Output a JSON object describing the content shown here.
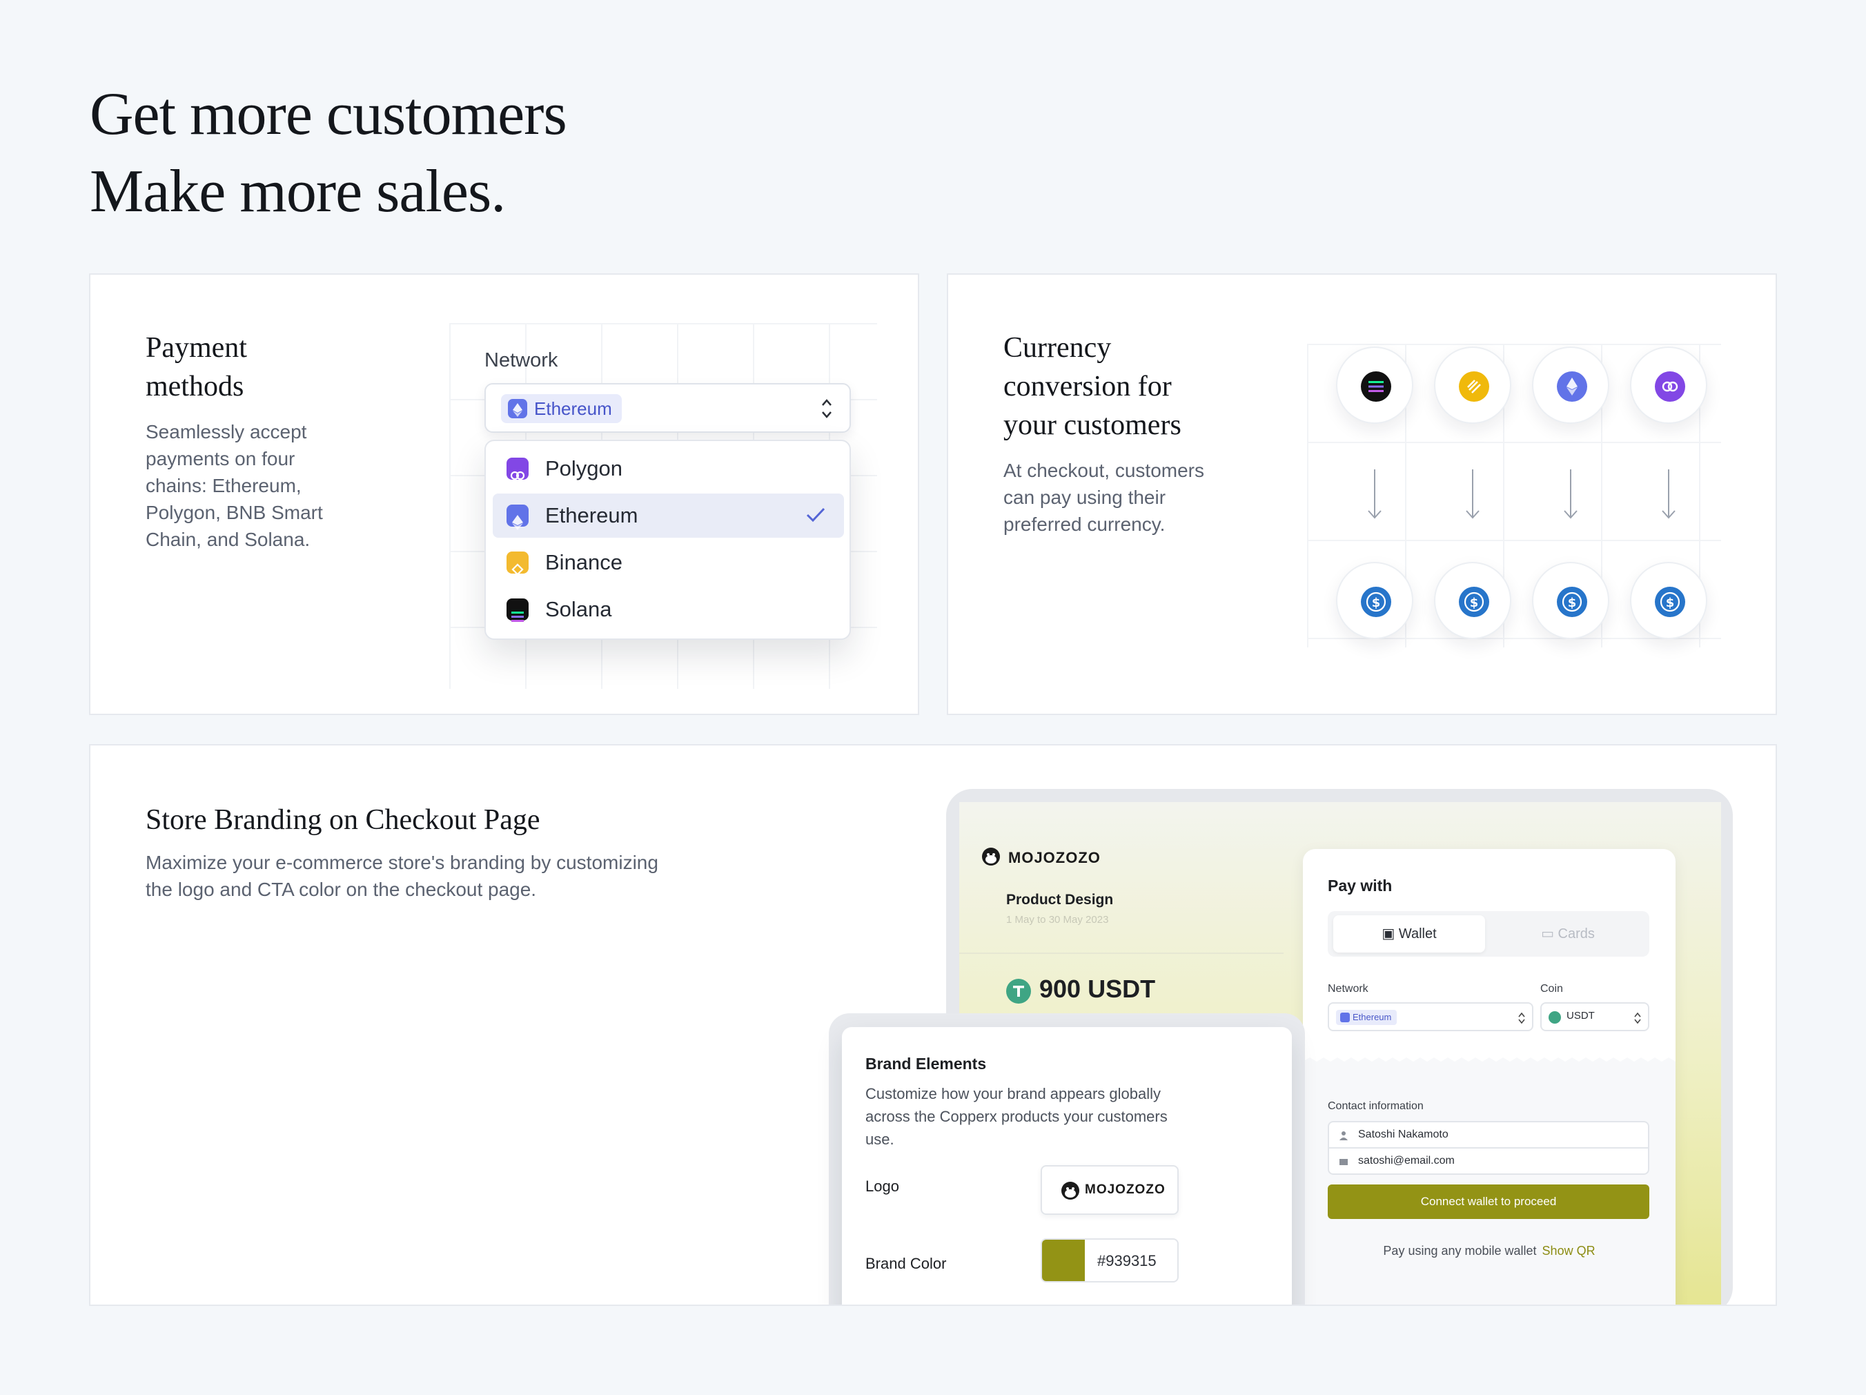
{
  "headline": {
    "line1": "Get more customers",
    "line2": "Make more sales."
  },
  "payment_card": {
    "title_line1": "Payment",
    "title_line2": "methods",
    "desc_line1": "Seamlessly accept",
    "desc_line2": "payments on four",
    "desc_line3": "chains: Ethereum,",
    "desc_line4": "Polygon, BNB Smart",
    "desc_line5": "Chain, and Solana.",
    "network_label": "Network",
    "selected_network": "Ethereum",
    "options": [
      {
        "label": "Polygon",
        "icon": "polygon-icon",
        "color": "#8247e5"
      },
      {
        "label": "Ethereum",
        "icon": "ethereum-icon",
        "color": "#6173e8"
      },
      {
        "label": "Binance",
        "icon": "binance-icon",
        "color": "#f3ba2f"
      },
      {
        "label": "Solana",
        "icon": "solana-icon",
        "color": "#111111"
      }
    ]
  },
  "currency_card": {
    "title_line1": "Currency",
    "title_line2": "conversion for",
    "title_line3": "your customers",
    "desc_line1": "At checkout, customers",
    "desc_line2": "can pay using their",
    "desc_line3": "preferred currency.",
    "from_coins": [
      "solana-icon",
      "binance-icon",
      "ethereum-icon",
      "polygon-icon"
    ],
    "to_coin": "usdc-icon"
  },
  "branding_card": {
    "title": "Store Branding on Checkout Page",
    "desc_line1": "Maximize your e-commerce store's branding by customizing",
    "desc_line2": "the logo and CTA color on the checkout page.",
    "checkout": {
      "merchant": "MOJOZOZO",
      "product": "Product Design",
      "dates": "1 May to 30 May 2023",
      "price": "900 USDT",
      "pay_with": "Pay with",
      "tab_wallet": "Wallet",
      "tab_cards": "Cards",
      "network_label": "Network",
      "network_value": "Ethereum",
      "coin_label": "Coin",
      "coin_value": "USDT",
      "contact_label": "Contact information",
      "name": "Satoshi Nakamoto",
      "email": "satoshi@email.com",
      "cta": "Connect wallet to proceed",
      "mobile_text": "Pay using any mobile wallet",
      "show_qr": "Show QR"
    },
    "brand_elements": {
      "title": "Brand Elements",
      "desc": "Customize how your brand appears globally across the Copperx products your customers use.",
      "logo_label": "Logo",
      "logo_text": "MOJOZOZO",
      "color_label": "Brand Color",
      "color_hex": "#939315"
    }
  },
  "colors": {
    "brand": "#939315",
    "ethereum": "#6173e8",
    "usdc": "#2775ca"
  }
}
